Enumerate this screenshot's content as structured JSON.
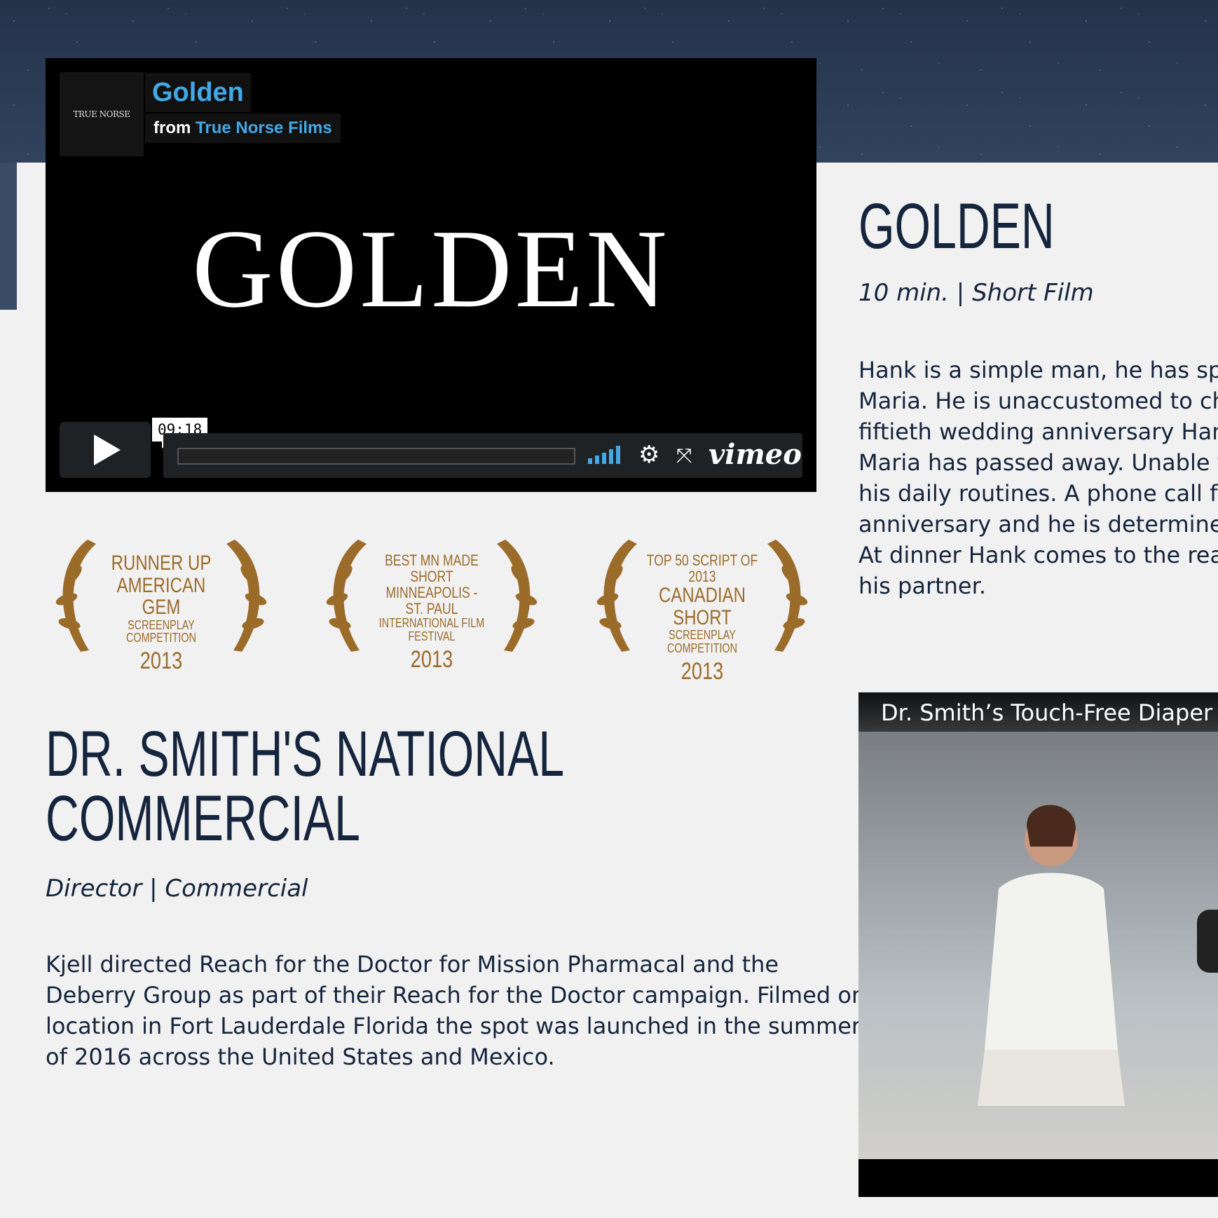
{
  "vimeo_player": {
    "logo_text": "TRUE NORSE",
    "title": "Golden",
    "by_prefix": "from",
    "owner": "True Norse Films",
    "poster_text": "GOLDEN",
    "time": "09:18",
    "brand": "vimeo",
    "icons": [
      "play-icon",
      "volume-icon",
      "settings-gear-icon",
      "fullscreen-icon"
    ]
  },
  "laurels": [
    {
      "line1": "RUNNER UP",
      "line2": "AMERICAN GEM",
      "line3": "SCREENPLAY COMPETITION",
      "year": "2013"
    },
    {
      "line1": "BEST MN MADE SHORT",
      "line2": "MINNEAPOLIS - ST. PAUL",
      "line3": "INTERNATIONAL FILM FESTIVAL",
      "year": "2013"
    },
    {
      "line1": "TOP 50 SCRIPT OF 2013",
      "line2": "CANADIAN SHORT",
      "line3": "SCREENPLAY COMPETITION",
      "year": "2013"
    }
  ],
  "golden": {
    "title": "GOLDEN",
    "meta": "10 min. | Short Film",
    "description_lines": [
      "Hank is a simple man, he has spen",
      "Maria. He is unaccustomed to char",
      "fiftieth wedding anniversary Hank",
      "Maria has passed away. Unable to",
      "his daily routines. A phone call fro",
      "anniversary and he is determined t",
      "At dinner Hank comes to the realiz",
      "his partner."
    ]
  },
  "drsmith": {
    "title_line1": "DR. SMITH'S NATIONAL",
    "title_line2": "COMMERCIAL",
    "meta": "Director | Commercial",
    "description_lines": [
      "Kjell directed Reach for the Doctor for Mission Pharmacal and the",
      "Deberry Group as part of their Reach for the Doctor campaign. Filmed on",
      "location in Fort Lauderdale Florida the spot was launched in the summer",
      "of 2016 across the United States and Mexico."
    ]
  },
  "youtube_player": {
    "title": "Dr. Smith’s Touch-Free Diaper"
  },
  "colors": {
    "heading": "#15253d",
    "vimeo_blue": "#44a8e6",
    "laurel_gold": "#9b6b2a",
    "panel_bg": "#f1f1f1"
  }
}
